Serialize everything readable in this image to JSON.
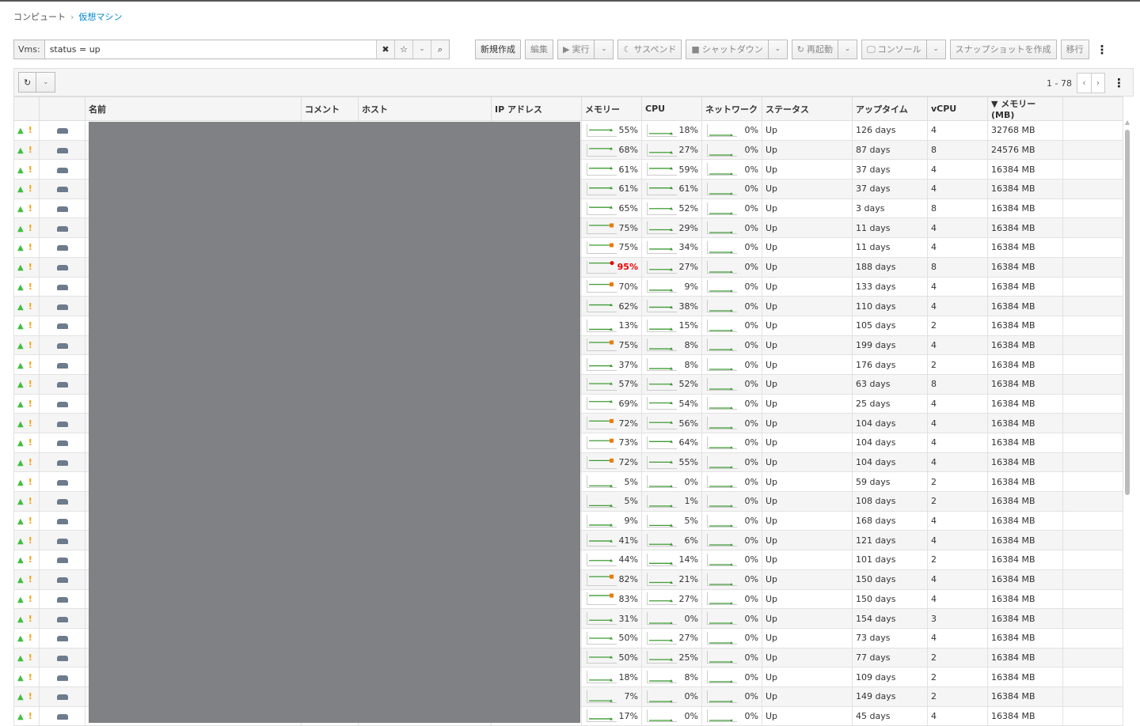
{
  "breadcrumb": {
    "parent": "コンピュート",
    "current": "仮想マシン"
  },
  "search": {
    "label": "Vms:",
    "value": "status = up"
  },
  "toolbar": {
    "new": "新規作成",
    "edit": "編集",
    "run": "実行",
    "suspend": "サスペンド",
    "shutdown": "シャットダウン",
    "reboot": "再起動",
    "console": "コンソール",
    "snapshot": "スナップショットを作成",
    "migrate": "移行"
  },
  "pager": {
    "range": "1 - 78"
  },
  "columns": [
    "",
    "",
    "名前",
    "コメント",
    "ホスト",
    "IP アドレス",
    "メモリー",
    "CPU",
    "ネットワーク",
    "ステータス",
    "アップタイム",
    "vCPU",
    "▼ メモリー (MB)",
    ""
  ],
  "colors": {
    "ok": "#3f9c35",
    "warn": "#ec7a08",
    "crit": "#e00000"
  },
  "rows": [
    {
      "mem": 55,
      "cpu": 18,
      "net": 0,
      "status": "Up",
      "uptime": "126 days",
      "vcpu": "4",
      "memmb": "32768 MB"
    },
    {
      "mem": 68,
      "cpu": 27,
      "net": 0,
      "status": "Up",
      "uptime": "87 days",
      "vcpu": "8",
      "memmb": "24576 MB"
    },
    {
      "mem": 61,
      "cpu": 59,
      "net": 0,
      "status": "Up",
      "uptime": "37 days",
      "vcpu": "4",
      "memmb": "16384 MB"
    },
    {
      "mem": 61,
      "cpu": 61,
      "net": 0,
      "status": "Up",
      "uptime": "37 days",
      "vcpu": "4",
      "memmb": "16384 MB"
    },
    {
      "mem": 65,
      "cpu": 52,
      "net": 0,
      "status": "Up",
      "uptime": "3 days",
      "vcpu": "8",
      "memmb": "16384 MB"
    },
    {
      "mem": 75,
      "cpu": 29,
      "net": 0,
      "status": "Up",
      "uptime": "11 days",
      "vcpu": "4",
      "memmb": "16384 MB"
    },
    {
      "mem": 75,
      "cpu": 34,
      "net": 0,
      "status": "Up",
      "uptime": "11 days",
      "vcpu": "4",
      "memmb": "16384 MB"
    },
    {
      "mem": 95,
      "cpu": 27,
      "net": 0,
      "status": "Up",
      "uptime": "188 days",
      "vcpu": "8",
      "memmb": "16384 MB"
    },
    {
      "mem": 70,
      "cpu": 9,
      "net": 0,
      "status": "Up",
      "uptime": "133 days",
      "vcpu": "4",
      "memmb": "16384 MB"
    },
    {
      "mem": 62,
      "cpu": 38,
      "net": 0,
      "status": "Up",
      "uptime": "110 days",
      "vcpu": "4",
      "memmb": "16384 MB"
    },
    {
      "mem": 13,
      "cpu": 15,
      "net": 0,
      "status": "Up",
      "uptime": "105 days",
      "vcpu": "2",
      "memmb": "16384 MB"
    },
    {
      "mem": 75,
      "cpu": 8,
      "net": 0,
      "status": "Up",
      "uptime": "199 days",
      "vcpu": "4",
      "memmb": "16384 MB"
    },
    {
      "mem": 37,
      "cpu": 8,
      "net": 0,
      "status": "Up",
      "uptime": "176 days",
      "vcpu": "2",
      "memmb": "16384 MB"
    },
    {
      "mem": 57,
      "cpu": 52,
      "net": 0,
      "status": "Up",
      "uptime": "63 days",
      "vcpu": "8",
      "memmb": "16384 MB"
    },
    {
      "mem": 69,
      "cpu": 54,
      "net": 0,
      "status": "Up",
      "uptime": "25 days",
      "vcpu": "4",
      "memmb": "16384 MB"
    },
    {
      "mem": 72,
      "cpu": 56,
      "net": 0,
      "status": "Up",
      "uptime": "104 days",
      "vcpu": "4",
      "memmb": "16384 MB"
    },
    {
      "mem": 73,
      "cpu": 64,
      "net": 0,
      "status": "Up",
      "uptime": "104 days",
      "vcpu": "4",
      "memmb": "16384 MB"
    },
    {
      "mem": 72,
      "cpu": 55,
      "net": 0,
      "status": "Up",
      "uptime": "104 days",
      "vcpu": "4",
      "memmb": "16384 MB"
    },
    {
      "mem": 5,
      "cpu": 0,
      "net": 0,
      "status": "Up",
      "uptime": "59 days",
      "vcpu": "2",
      "memmb": "16384 MB"
    },
    {
      "mem": 5,
      "cpu": 1,
      "net": 0,
      "status": "Up",
      "uptime": "108 days",
      "vcpu": "2",
      "memmb": "16384 MB"
    },
    {
      "mem": 9,
      "cpu": 5,
      "net": 0,
      "status": "Up",
      "uptime": "168 days",
      "vcpu": "4",
      "memmb": "16384 MB"
    },
    {
      "mem": 41,
      "cpu": 6,
      "net": 0,
      "status": "Up",
      "uptime": "121 days",
      "vcpu": "4",
      "memmb": "16384 MB"
    },
    {
      "mem": 44,
      "cpu": 14,
      "net": 0,
      "status": "Up",
      "uptime": "101 days",
      "vcpu": "2",
      "memmb": "16384 MB"
    },
    {
      "mem": 82,
      "cpu": 21,
      "net": 0,
      "status": "Up",
      "uptime": "150 days",
      "vcpu": "4",
      "memmb": "16384 MB"
    },
    {
      "mem": 83,
      "cpu": 27,
      "net": 0,
      "status": "Up",
      "uptime": "150 days",
      "vcpu": "4",
      "memmb": "16384 MB"
    },
    {
      "mem": 31,
      "cpu": 0,
      "net": 0,
      "status": "Up",
      "uptime": "154 days",
      "vcpu": "3",
      "memmb": "16384 MB"
    },
    {
      "mem": 50,
      "cpu": 27,
      "net": 0,
      "status": "Up",
      "uptime": "73 days",
      "vcpu": "4",
      "memmb": "16384 MB"
    },
    {
      "mem": 50,
      "cpu": 25,
      "net": 0,
      "status": "Up",
      "uptime": "77 days",
      "vcpu": "2",
      "memmb": "16384 MB"
    },
    {
      "mem": 18,
      "cpu": 8,
      "net": 0,
      "status": "Up",
      "uptime": "109 days",
      "vcpu": "2",
      "memmb": "16384 MB"
    },
    {
      "mem": 7,
      "cpu": 0,
      "net": 0,
      "status": "Up",
      "uptime": "149 days",
      "vcpu": "2",
      "memmb": "16384 MB"
    },
    {
      "mem": 17,
      "cpu": 0,
      "net": 0,
      "status": "Up",
      "uptime": "45 days",
      "vcpu": "4",
      "memmb": "16384 MB"
    }
  ]
}
